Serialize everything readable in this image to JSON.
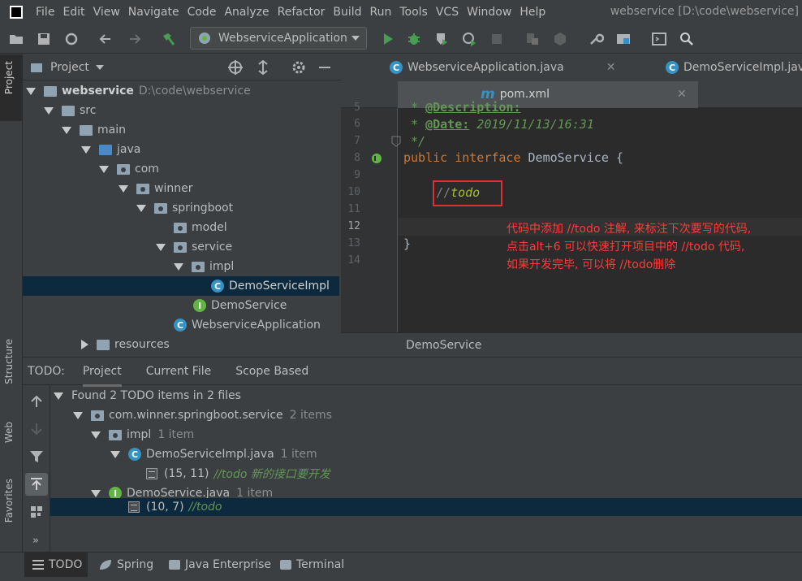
{
  "menubar": {
    "items": [
      "File",
      "Edit",
      "View",
      "Navigate",
      "Code",
      "Analyze",
      "Refactor",
      "Build",
      "Run",
      "Tools",
      "VCS",
      "Window",
      "Help"
    ],
    "window_title": "webservice [D:\\code\\webservice]"
  },
  "toolbar": {
    "run_config": "WebserviceApplication",
    "icons": [
      "open-folder-icon",
      "save-icon",
      "sync-icon",
      "back-arrow-icon",
      "forward-arrow-icon",
      "build-hammer-icon",
      "run-icon",
      "debug-icon",
      "coverage-icon",
      "profile-icon",
      "stop-icon",
      "attach-icon",
      "deploy-icon",
      "settings-wrench-icon",
      "project-structure-icon",
      "terminal-icon",
      "search-icon"
    ]
  },
  "leftstrip": {
    "project": "Project",
    "structure": "Structure",
    "web": "Web",
    "favorites": "Favorites"
  },
  "project_panel": {
    "title": "Project",
    "tree": [
      {
        "label": "webservice",
        "suffix": "D:\\code\\webservice"
      },
      {
        "label": "src"
      },
      {
        "label": "main"
      },
      {
        "label": "java"
      },
      {
        "label": "com"
      },
      {
        "label": "winner"
      },
      {
        "label": "springboot"
      },
      {
        "label": "model"
      },
      {
        "label": "service"
      },
      {
        "label": "impl"
      },
      {
        "label": "DemoServiceImpl"
      },
      {
        "label": "DemoService"
      },
      {
        "label": "WebserviceApplication"
      },
      {
        "label": "resources"
      }
    ]
  },
  "editor": {
    "tabs": [
      "WebserviceApplication.java",
      "DemoServiceImpl.java",
      "pom.xml"
    ],
    "line_numbers": [
      "5",
      "6",
      "7",
      "8",
      "9",
      "10",
      "11",
      "12",
      "13",
      "14"
    ],
    "code": {
      "l5_tag": "@Description:",
      "l6_star": " * ",
      "l6_tag": "@Date:",
      "l6_value": " 2019/11/13/16:31",
      "l7": " */",
      "l8_kw1": "public",
      "l8_kw2": "interface",
      "l8_rest": " DemoService {",
      "l10_slashes": "//",
      "l10_todo": "todo",
      "l13": "}"
    },
    "annotation": [
      "代码中添加 //todo 注解, 来标注下次要写的代码,",
      "点击alt+6 可以快速打开项目中的 //todo 代码,",
      "如果开发完毕, 可以将 //todo删除"
    ],
    "footer": "DemoService"
  },
  "todo_panel": {
    "label": "TODO:",
    "tabs": [
      "Project",
      "Current File",
      "Scope Based"
    ],
    "rows": [
      {
        "text": "Found 2 TODO items in 2 files",
        "count": ""
      },
      {
        "text": "com.winner.springboot.service",
        "count": "2 items"
      },
      {
        "text": "impl",
        "count": "1 item"
      },
      {
        "text": "DemoServiceImpl.java",
        "count": "1 item"
      },
      {
        "pos": "(15, 11)",
        "comment": "//todo 新的接口要开发"
      },
      {
        "text": "DemoService.java",
        "count": "1 item"
      },
      {
        "pos": "(10, 7)",
        "comment": "//todo"
      }
    ]
  },
  "bottombar": {
    "tabs": [
      "TODO",
      "Spring",
      "Java Enterprise",
      "Terminal"
    ]
  }
}
